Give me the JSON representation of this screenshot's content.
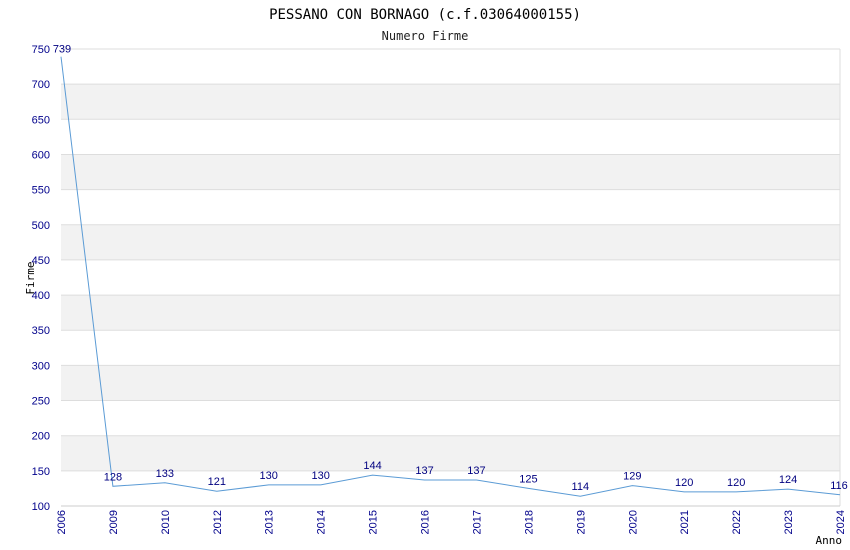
{
  "chart_data": {
    "type": "line",
    "title": "PESSANO CON BORNAGO (c.f.03064000155)",
    "subtitle": "Numero Firme",
    "xlabel": "Anno",
    "ylabel": "Firme",
    "x": [
      "2006",
      "2009",
      "2010",
      "2012",
      "2013",
      "2014",
      "2015",
      "2016",
      "2017",
      "2018",
      "2019",
      "2020",
      "2021",
      "2022",
      "2023",
      "2024"
    ],
    "series": [
      {
        "values": [
          739,
          128,
          133,
          121,
          130,
          130,
          144,
          137,
          137,
          125,
          114,
          129,
          120,
          120,
          124,
          116
        ]
      }
    ],
    "ylim": [
      100,
      750
    ],
    "yticks": [
      100,
      150,
      200,
      250,
      300,
      350,
      400,
      450,
      500,
      550,
      600,
      650,
      700,
      750
    ],
    "grid": true,
    "colors": {
      "line": "#5b9bd5",
      "band_light": "#ffffff",
      "band_dark": "#f2f2f2",
      "gridline": "#dddddd",
      "tick_text": "#00008b",
      "label_text": "#000080"
    }
  }
}
